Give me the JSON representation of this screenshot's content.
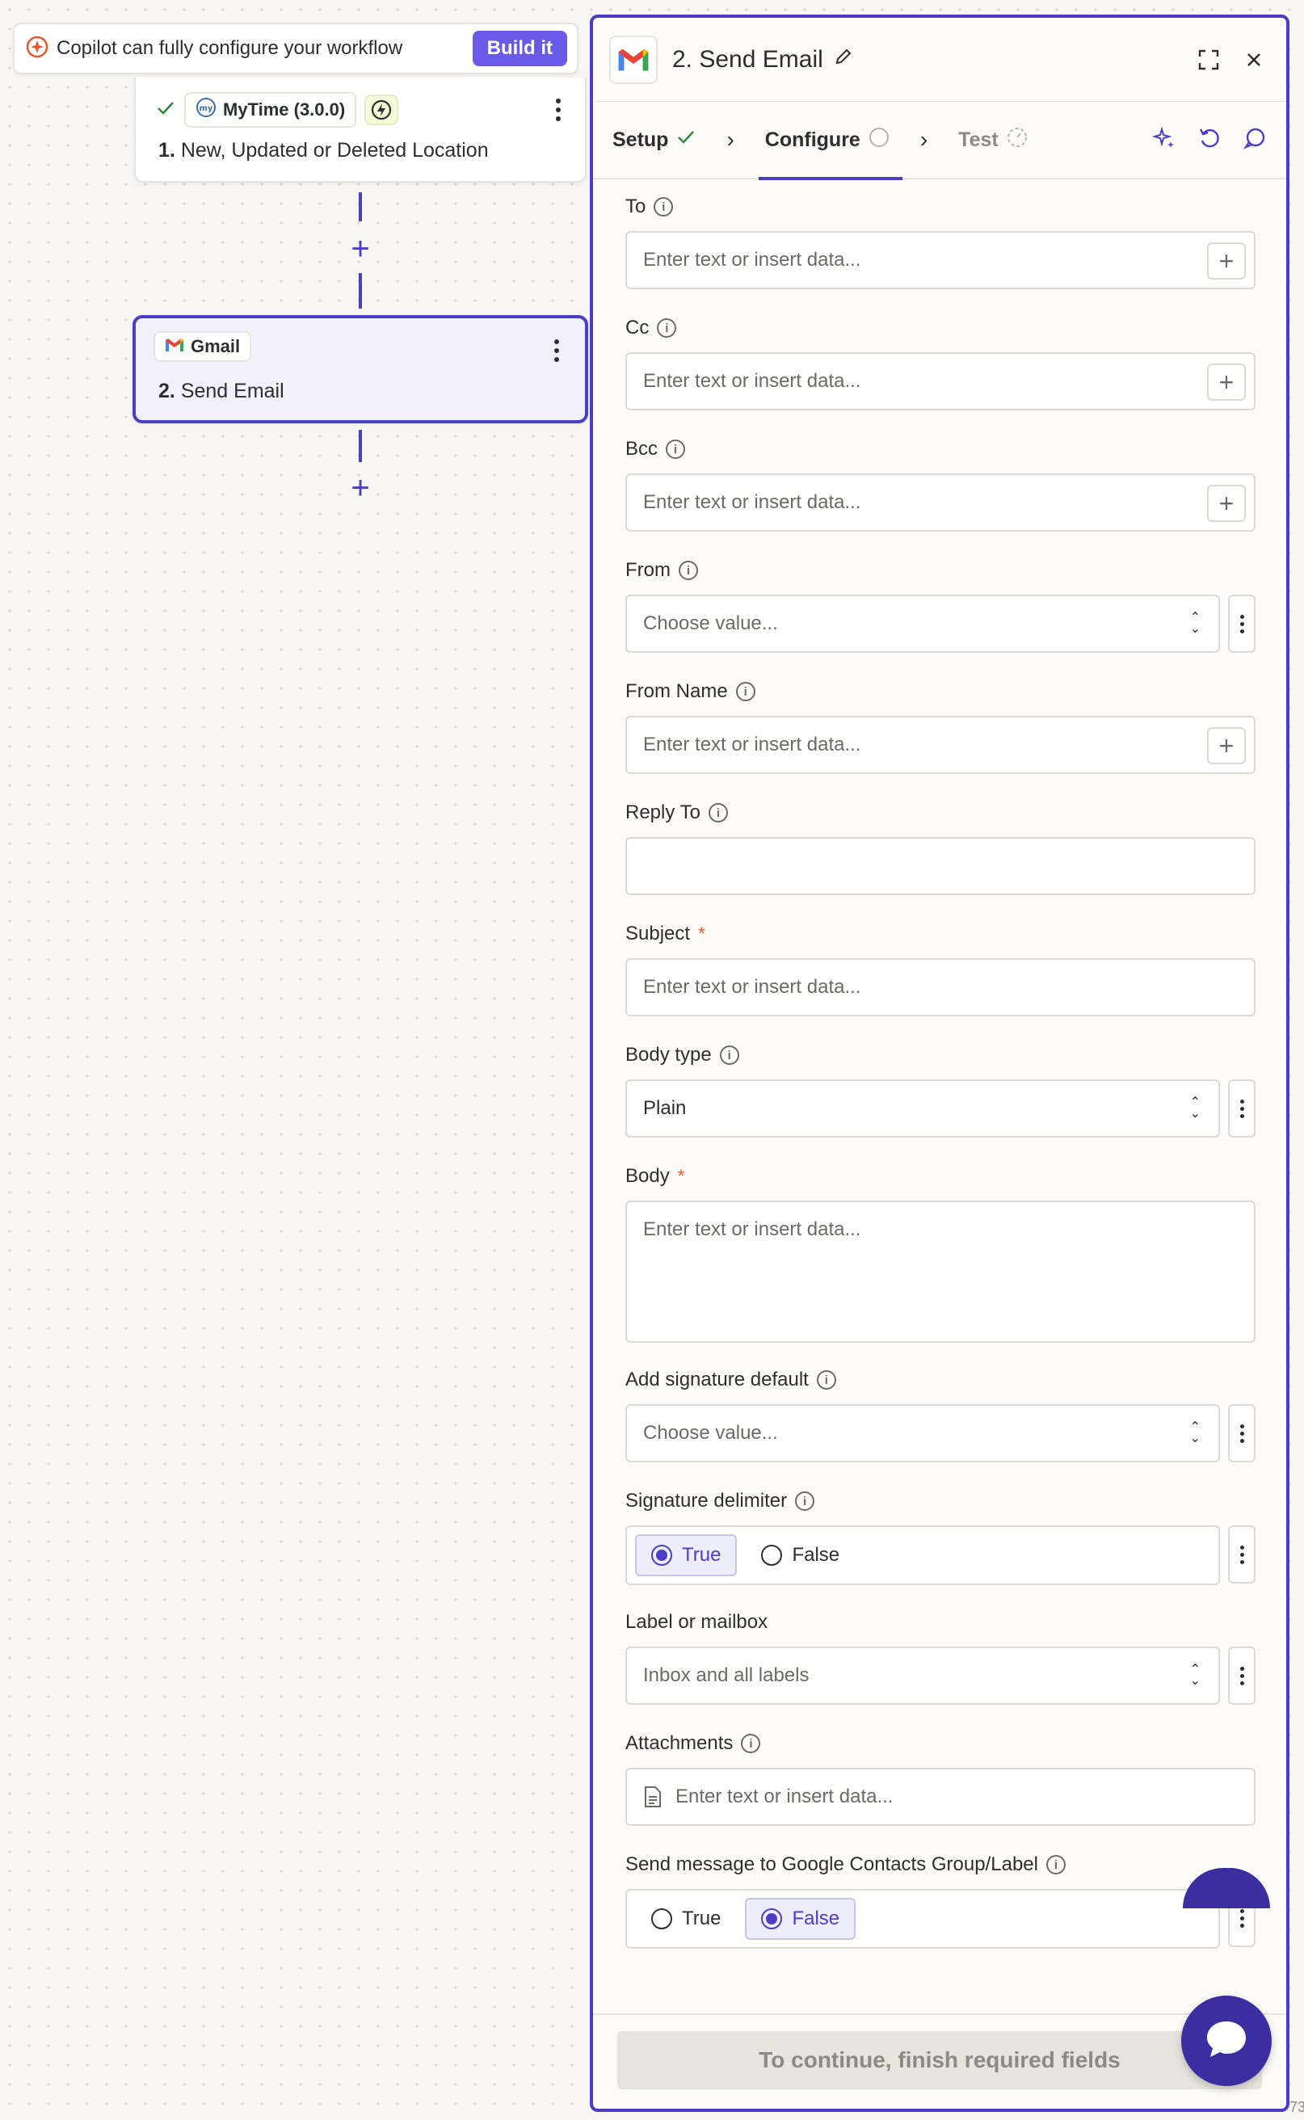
{
  "copilot": {
    "text": "Copilot can fully configure your workflow",
    "button": "Build it"
  },
  "trigger_node": {
    "app": "MyTime (3.0.0)",
    "step_num": "1.",
    "step_title": "New, Updated or Deleted Location"
  },
  "action_node": {
    "app": "Gmail",
    "step_num": "2.",
    "step_title": "Send Email"
  },
  "panel": {
    "title": "2. Send Email",
    "tabs": {
      "setup": "Setup",
      "configure": "Configure",
      "test": "Test"
    },
    "fields": {
      "to": {
        "label": "To",
        "placeholder": "Enter text or insert data..."
      },
      "cc": {
        "label": "Cc",
        "placeholder": "Enter text or insert data..."
      },
      "bcc": {
        "label": "Bcc",
        "placeholder": "Enter text or insert data..."
      },
      "from": {
        "label": "From",
        "placeholder": "Choose value..."
      },
      "from_name": {
        "label": "From Name",
        "placeholder": "Enter text or insert data..."
      },
      "reply_to": {
        "label": "Reply To",
        "placeholder": ""
      },
      "subject": {
        "label": "Subject",
        "placeholder": "Enter text or insert data..."
      },
      "body_type": {
        "label": "Body type",
        "value": "Plain"
      },
      "body": {
        "label": "Body",
        "placeholder": "Enter text or insert data..."
      },
      "signature_default": {
        "label": "Add signature default",
        "placeholder": "Choose value..."
      },
      "signature_delimiter": {
        "label": "Signature delimiter",
        "opt_true": "True",
        "opt_false": "False",
        "selected": "True"
      },
      "label_mailbox": {
        "label": "Label or mailbox",
        "placeholder": "Inbox and all labels"
      },
      "attachments": {
        "label": "Attachments",
        "placeholder": "Enter text or insert data..."
      },
      "contacts_group": {
        "label": "Send message to Google Contacts Group/Label",
        "opt_true": "True",
        "opt_false": "False",
        "selected": "False"
      }
    },
    "continue_label": "To continue, finish required fields"
  },
  "corner_num": "73",
  "colors": {
    "accent": "#4c3ec4",
    "build_button": "#695be8",
    "required": "#e8562d"
  }
}
